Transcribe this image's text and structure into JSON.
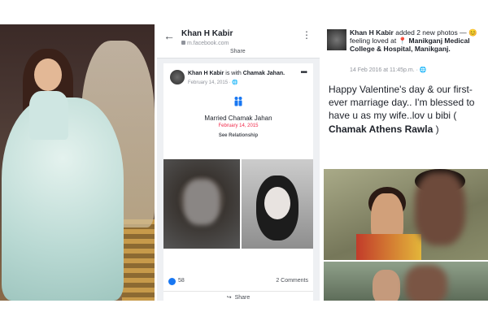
{
  "phone": {
    "back_icon": "←",
    "title": "Khan H Kabir",
    "url": "m.facebook.com",
    "more_icon": "⋮",
    "share_top": "Share",
    "post_author": "Khan H Kabir",
    "post_with": "is with",
    "post_tagged": "Chamak Jahan.",
    "post_date": "February 14, 2015 · 🌐",
    "post_more": "•••",
    "event_title": "Married Chamak Jahan",
    "event_date": "February 14, 2015",
    "see_relationship": "See Relationship",
    "like_count": "58",
    "comments": "2 Comments",
    "share_label": "Share",
    "share_icon": "↪"
  },
  "post": {
    "author": "Khan H Kabir",
    "action": "added 2 new photos — 😊 feeling loved at",
    "location": "📍 Manikganj Medical College & Hospital,",
    "location_city": "Manikganj.",
    "date": "14 Feb 2016 at 11:45p.m. · 🌐",
    "body_text": "Happy Valentine's day & our first-ever marriage day.. I'm blessed to have u as my wife..lov u bibi (",
    "body_tag": "Chamak Athens Rawla",
    "body_end": ")"
  },
  "colors": {
    "fb_blue": "#1877f2",
    "event_red": "#f02849"
  }
}
